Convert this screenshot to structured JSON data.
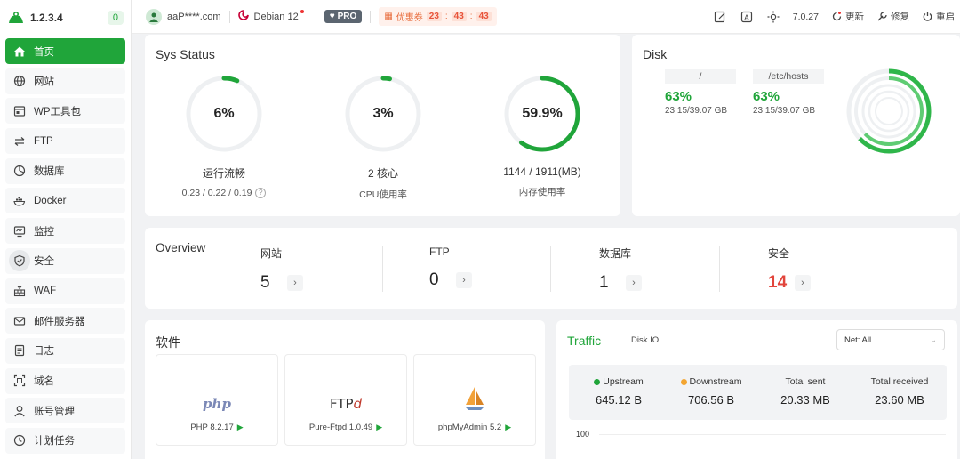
{
  "brand": {
    "version": "1.2.3.4",
    "badge": "0",
    "accent": "#20a53a"
  },
  "sidebar": {
    "items": [
      {
        "label": "首页",
        "icon": "home-icon"
      },
      {
        "label": "网站",
        "icon": "globe-icon"
      },
      {
        "label": "WP工具包",
        "icon": "wordpress-toolkit-icon"
      },
      {
        "label": "FTP",
        "icon": "transfer-arrows-icon"
      },
      {
        "label": "数据库",
        "icon": "database-pie-icon"
      },
      {
        "label": "Docker",
        "icon": "docker-whale-icon"
      },
      {
        "label": "监控",
        "icon": "monitor-icon"
      },
      {
        "label": "安全",
        "icon": "shield-icon"
      },
      {
        "label": "WAF",
        "icon": "firewall-icon"
      },
      {
        "label": "邮件服务器",
        "icon": "mail-icon"
      },
      {
        "label": "日志",
        "icon": "log-file-icon"
      },
      {
        "label": "域名",
        "icon": "domain-scan-icon"
      },
      {
        "label": "账号管理",
        "icon": "user-icon"
      },
      {
        "label": "计划任务",
        "icon": "clock-icon"
      }
    ]
  },
  "topbar": {
    "user": "aaP****.com",
    "os": "Debian 12",
    "pro": "PRO",
    "coupon_label": "优惠券",
    "countdown": [
      "23",
      "43",
      "43"
    ],
    "panel_version": "7.0.27",
    "update_label": "更新",
    "repair_label": "修复",
    "restart_label": "重启"
  },
  "sys_status": {
    "title": "Sys Status",
    "gauges": [
      {
        "value_text": "6%",
        "percent": 6,
        "label": "运行流畅",
        "sub": "0.23 / 0.22 / 0.19"
      },
      {
        "value_text": "3%",
        "percent": 3,
        "label": "2 核心",
        "sub": "CPU使用率"
      },
      {
        "value_text": "59.9%",
        "percent": 59.9,
        "label": "1144 / 1911(MB)",
        "sub": "内存使用率"
      }
    ]
  },
  "disk": {
    "title": "Disk",
    "items": [
      {
        "path": "/",
        "percent_text": "63%",
        "size": "23.15/39.07 GB"
      },
      {
        "path": "/etc/hosts",
        "percent_text": "63%",
        "size": "23.15/39.07 GB"
      }
    ]
  },
  "overview": {
    "title": "Overview",
    "items": [
      {
        "label": "网站",
        "value": "5"
      },
      {
        "label": "FTP",
        "value": "0"
      },
      {
        "label": "数据库",
        "value": "1"
      },
      {
        "label": "安全",
        "value": "14"
      }
    ]
  },
  "software": {
    "title": "软件",
    "items": [
      {
        "logo": "php",
        "name": "PHP 8.2.17"
      },
      {
        "logo": "FTP",
        "name": "Pure-Ftpd 1.0.49"
      },
      {
        "logo": "phpmyadmin-sailboat-icon",
        "name": "phpMyAdmin 5.2"
      }
    ]
  },
  "traffic": {
    "tab_active": "Traffic",
    "tab_other": "Disk IO",
    "select_value": "Net: All",
    "stats": [
      {
        "label": "Upstream",
        "value": "645.12 B",
        "dot": "#20a53a"
      },
      {
        "label": "Downstream",
        "value": "706.56 B",
        "dot": "#f3a531"
      },
      {
        "label": "Total sent",
        "value": "20.33 MB"
      },
      {
        "label": "Total received",
        "value": "23.60 MB"
      }
    ],
    "axis_label": "100"
  }
}
